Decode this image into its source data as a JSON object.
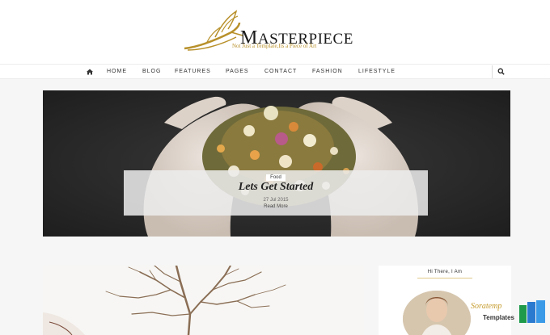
{
  "brand": {
    "title_first": "M",
    "title_rest": "ASTERPIECE",
    "tagline": "Not Just a Template,Its a Piece of Art",
    "accent": "#b8902a"
  },
  "nav": {
    "home_icon": "home-icon",
    "items": [
      "HOME",
      "BLOG",
      "FEATURES",
      "PAGES",
      "CONTACT",
      "FASHION",
      "LIFESTYLE"
    ],
    "search_icon": "search-icon"
  },
  "hero": {
    "tag": "Food",
    "title": "Lets Get Started",
    "date": "27 Jul 2015",
    "read_more": "Read More"
  },
  "sidebar": {
    "widget_title": "Hi There, I Am"
  },
  "watermark": {
    "line1": "Soratemp",
    "line2": "Templates"
  }
}
